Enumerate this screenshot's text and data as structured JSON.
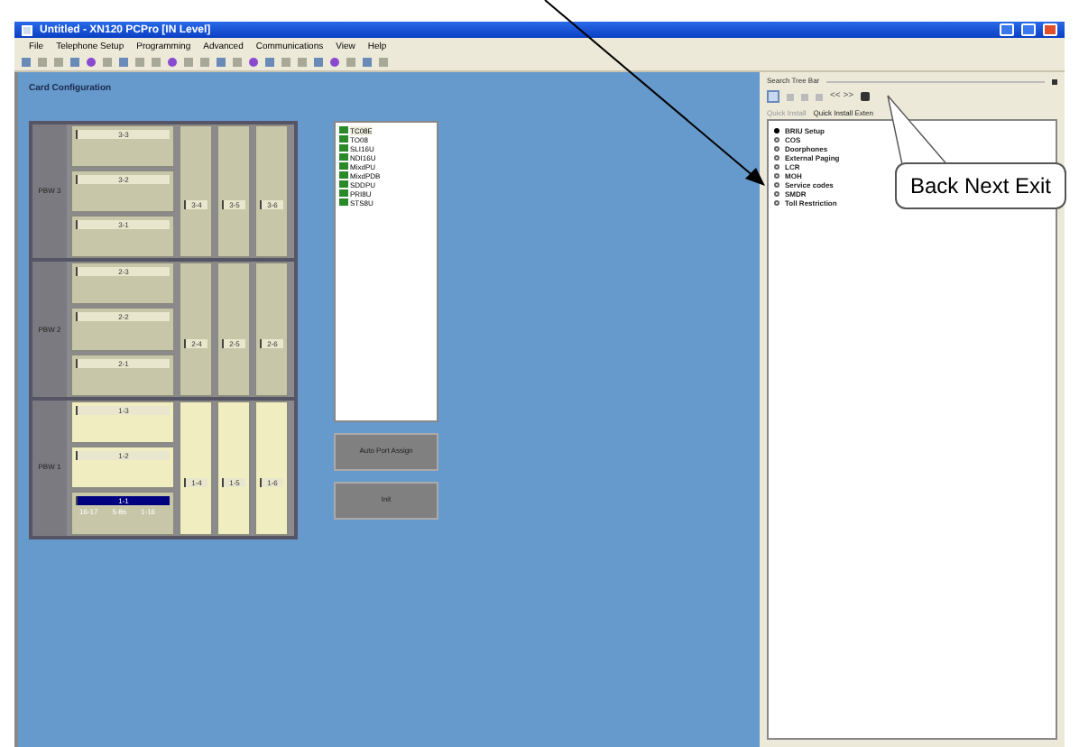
{
  "window": {
    "title": "Untitled - XN120 PCPro [IN Level]"
  },
  "menu": [
    "File",
    "Telephone Setup",
    "Programming",
    "Advanced",
    "Communications",
    "View",
    "Help"
  ],
  "page_title": "Card Configuration",
  "cabinets": [
    {
      "label": "PBW 3",
      "wide_slots": [
        {
          "label": "3-3",
          "populated": false,
          "selected": false
        },
        {
          "label": "3-2",
          "populated": false,
          "selected": false
        },
        {
          "label": "3-1",
          "populated": false,
          "selected": false
        }
      ],
      "narrow_slots": [
        {
          "label": "3-4",
          "populated": false,
          "selected": false
        },
        {
          "label": "3-5",
          "populated": false,
          "selected": false
        },
        {
          "label": "3-6",
          "populated": false,
          "selected": false
        }
      ]
    },
    {
      "label": "PBW 2",
      "wide_slots": [
        {
          "label": "2-3",
          "populated": false,
          "selected": false
        },
        {
          "label": "2-2",
          "populated": false,
          "selected": false
        },
        {
          "label": "2-1",
          "populated": false,
          "selected": false
        }
      ],
      "narrow_slots": [
        {
          "label": "2-4",
          "populated": false,
          "selected": false
        },
        {
          "label": "2-5",
          "populated": false,
          "selected": false
        },
        {
          "label": "2-6",
          "populated": false,
          "selected": false
        }
      ]
    },
    {
      "label": "PBW 1",
      "wide_slots": [
        {
          "label": "1-3",
          "populated": true,
          "selected": false
        },
        {
          "label": "1-2",
          "populated": true,
          "selected": false
        },
        {
          "label": "1-1",
          "populated": false,
          "selected": true,
          "details": [
            "16-17",
            "5-8s",
            "1-16"
          ]
        }
      ],
      "narrow_slots": [
        {
          "label": "1-4",
          "populated": true,
          "selected": false
        },
        {
          "label": "1-5",
          "populated": true,
          "selected": false
        },
        {
          "label": "1-6",
          "populated": true,
          "selected": false
        }
      ]
    }
  ],
  "card_list": [
    {
      "label": "TC08E",
      "selected": true
    },
    {
      "label": "TO08",
      "selected": false
    },
    {
      "label": "SLI16U",
      "selected": false
    },
    {
      "label": "NDI16U",
      "selected": false
    },
    {
      "label": "MixdPU",
      "selected": false
    },
    {
      "label": "MixdPDB",
      "selected": false
    },
    {
      "label": "SDDPU",
      "selected": false
    },
    {
      "label": "PRI8U",
      "selected": false
    },
    {
      "label": "STS8U",
      "selected": false
    }
  ],
  "buttons": [
    "Auto Port Assign",
    "Init"
  ],
  "search_tree": {
    "title": "Search Tree Bar",
    "nav": "<< >>",
    "tabs": [
      {
        "label": "Quick Install",
        "selected": false
      },
      {
        "label": "Quick Install Exten",
        "selected": true
      }
    ],
    "items": [
      {
        "label": "BRIU Setup",
        "selected": true
      },
      {
        "label": "COS",
        "selected": false
      },
      {
        "label": "Doorphones",
        "selected": false
      },
      {
        "label": "External Paging",
        "selected": false
      },
      {
        "label": "LCR",
        "selected": false
      },
      {
        "label": "MOH",
        "selected": false
      },
      {
        "label": "Service codes",
        "selected": false
      },
      {
        "label": "SMDR",
        "selected": false
      },
      {
        "label": "Toll Restriction",
        "selected": false
      }
    ]
  },
  "callout": "Back Next Exit"
}
